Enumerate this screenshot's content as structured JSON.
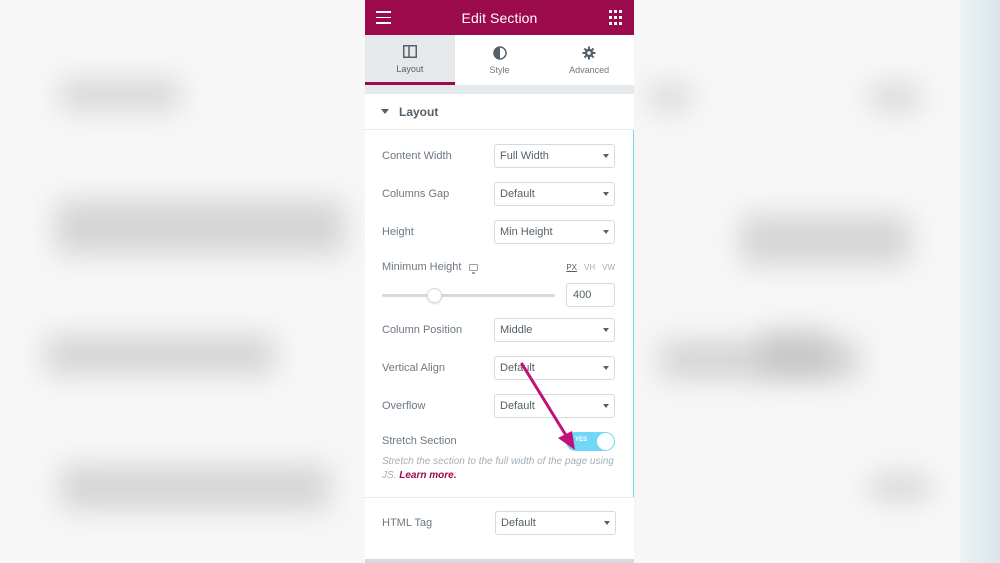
{
  "header": {
    "title": "Edit Section"
  },
  "tabs": [
    {
      "label": "Layout",
      "icon": "columns-icon",
      "active": true
    },
    {
      "label": "Style",
      "icon": "contrast-icon",
      "active": false
    },
    {
      "label": "Advanced",
      "icon": "gear-icon",
      "active": false
    }
  ],
  "section": {
    "title": "Layout"
  },
  "controls": {
    "content_width": {
      "label": "Content Width",
      "value": "Full Width"
    },
    "columns_gap": {
      "label": "Columns Gap",
      "value": "Default"
    },
    "height": {
      "label": "Height",
      "value": "Min Height"
    },
    "min_height": {
      "label": "Minimum Height",
      "units": [
        "PX",
        "VH",
        "VW"
      ],
      "active_unit": "PX",
      "value": "400",
      "slider_fraction": 0.3
    },
    "column_position": {
      "label": "Column Position",
      "value": "Middle"
    },
    "vertical_align": {
      "label": "Vertical Align",
      "value": "Default"
    },
    "overflow": {
      "label": "Overflow",
      "value": "Default"
    },
    "stretch_section": {
      "label": "Stretch Section",
      "toggle_text": "YES",
      "on": true,
      "description": "Stretch the section to the full width of the page using JS.",
      "learn_more": "Learn more."
    },
    "html_tag": {
      "label": "HTML Tag",
      "value": "Default"
    }
  },
  "colors": {
    "brand": "#9b0a4a",
    "accent": "#71d7f7",
    "annotation_arrow": "#c0117a"
  }
}
